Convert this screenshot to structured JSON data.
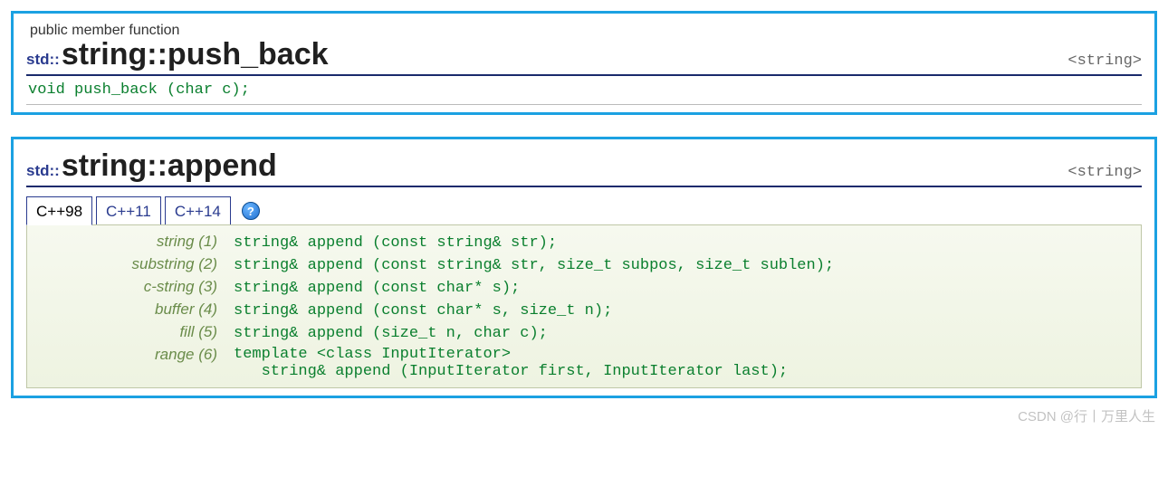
{
  "panel1": {
    "subtitle": "public member function",
    "namespace": "std::",
    "name": "string::push_back",
    "header": "<string>",
    "signature": "void push_back (char c);"
  },
  "panel2": {
    "namespace": "std::",
    "name": "string::append",
    "header": "<string>",
    "tabs": [
      "C++98",
      "C++11",
      "C++14"
    ],
    "overloads": [
      {
        "label": "string (1)",
        "sig": "string& append (const string& str);"
      },
      {
        "label": "substring (2)",
        "sig": "string& append (const string& str, size_t subpos, size_t sublen);"
      },
      {
        "label": "c-string (3)",
        "sig": "string& append (const char* s);"
      },
      {
        "label": "buffer (4)",
        "sig": "string& append (const char* s, size_t n);"
      },
      {
        "label": "fill (5)",
        "sig": "string& append (size_t n, char c);"
      },
      {
        "label": "range (6)",
        "sig": "template <class InputIterator>\n   string& append (InputIterator first, InputIterator last);"
      }
    ]
  },
  "help_glyph": "?",
  "watermark": "CSDN @行丨万里人生"
}
